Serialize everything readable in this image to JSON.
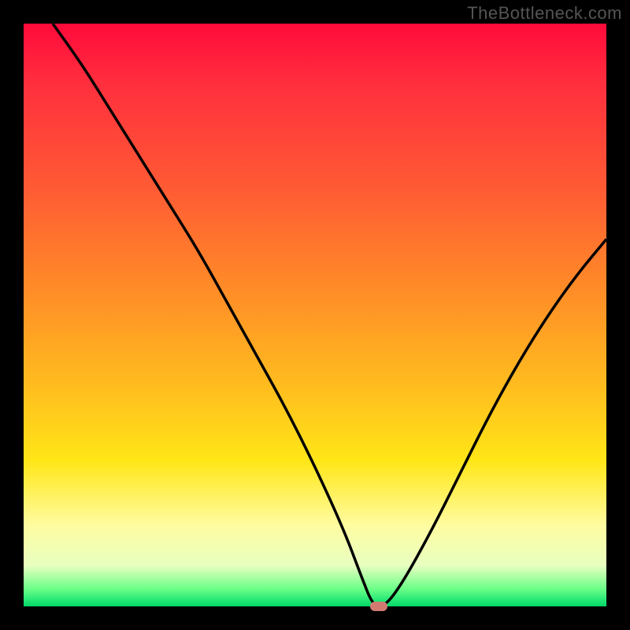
{
  "watermark": "TheBottleneck.com",
  "chart_data": {
    "type": "line",
    "title": "",
    "xlabel": "",
    "ylabel": "",
    "xlim": [
      0,
      100
    ],
    "ylim": [
      0,
      100
    ],
    "grid": false,
    "legend": false,
    "background": {
      "style": "vertical-gradient",
      "top_color": "#ff0a3a",
      "bottom_color": "#00d96a",
      "meaning": "bottleneck percentage (top=100, bottom=0)"
    },
    "series": [
      {
        "name": "bottleneck-curve",
        "color": "#000000",
        "x": [
          5,
          10,
          15,
          20,
          25,
          30,
          35,
          40,
          45,
          50,
          55,
          58,
          60,
          62,
          65,
          70,
          75,
          80,
          85,
          90,
          95,
          100
        ],
        "y": [
          100,
          93,
          85,
          77,
          69,
          61,
          52,
          43,
          34,
          24,
          13,
          5,
          0,
          0,
          4,
          13,
          23,
          33,
          42,
          50,
          57,
          63
        ]
      }
    ],
    "marker": {
      "name": "optimal-point",
      "x": 61,
      "y": 0,
      "color": "#d07a72"
    }
  }
}
